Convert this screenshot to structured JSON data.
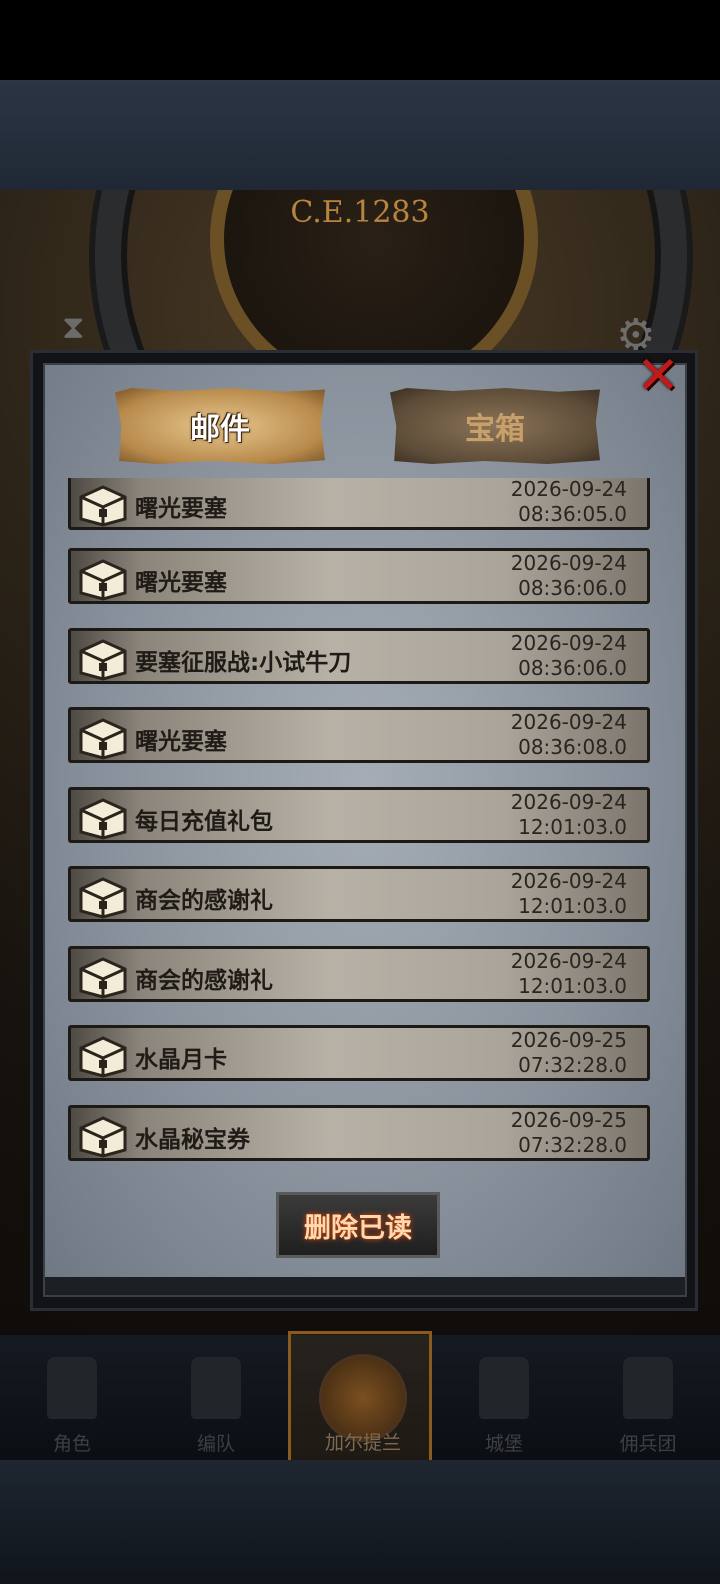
{
  "scene": {
    "era_label": "C.E.1283"
  },
  "tabs": [
    {
      "label": "邮件",
      "active": true
    },
    {
      "label": "宝箱",
      "active": false
    }
  ],
  "mail_items": [
    {
      "title": "曙光要塞",
      "date": "2026-09-24",
      "time": "08:36:05.0"
    },
    {
      "title": "曙光要塞",
      "date": "2026-09-24",
      "time": "08:36:06.0"
    },
    {
      "title": "要塞征服战:小试牛刀",
      "date": "2026-09-24",
      "time": "08:36:06.0"
    },
    {
      "title": "曙光要塞",
      "date": "2026-09-24",
      "time": "08:36:08.0"
    },
    {
      "title": "每日充值礼包",
      "date": "2026-09-24",
      "time": "12:01:03.0"
    },
    {
      "title": "商会的感谢礼",
      "date": "2026-09-24",
      "time": "12:01:03.0"
    },
    {
      "title": "商会的感谢礼",
      "date": "2026-09-24",
      "time": "12:01:03.0"
    },
    {
      "title": "水晶月卡",
      "date": "2026-09-25",
      "time": "07:32:28.0"
    },
    {
      "title": "水晶秘宝券",
      "date": "2026-09-25",
      "time": "07:32:28.0"
    }
  ],
  "delete_button": {
    "label": "删除已读"
  },
  "nav": [
    {
      "label": "角色",
      "icon": "knight-icon"
    },
    {
      "label": "编队",
      "icon": "warrior-icon"
    },
    {
      "label": "加尔提兰",
      "icon": "compass-map-icon",
      "active": true
    },
    {
      "label": "城堡",
      "icon": "castle-icon"
    },
    {
      "label": "佣兵团",
      "icon": "ship-icon"
    }
  ],
  "colors": {
    "accent": "#b88a4c",
    "close": "#c11a1a",
    "button_glow": "#d04a10"
  }
}
